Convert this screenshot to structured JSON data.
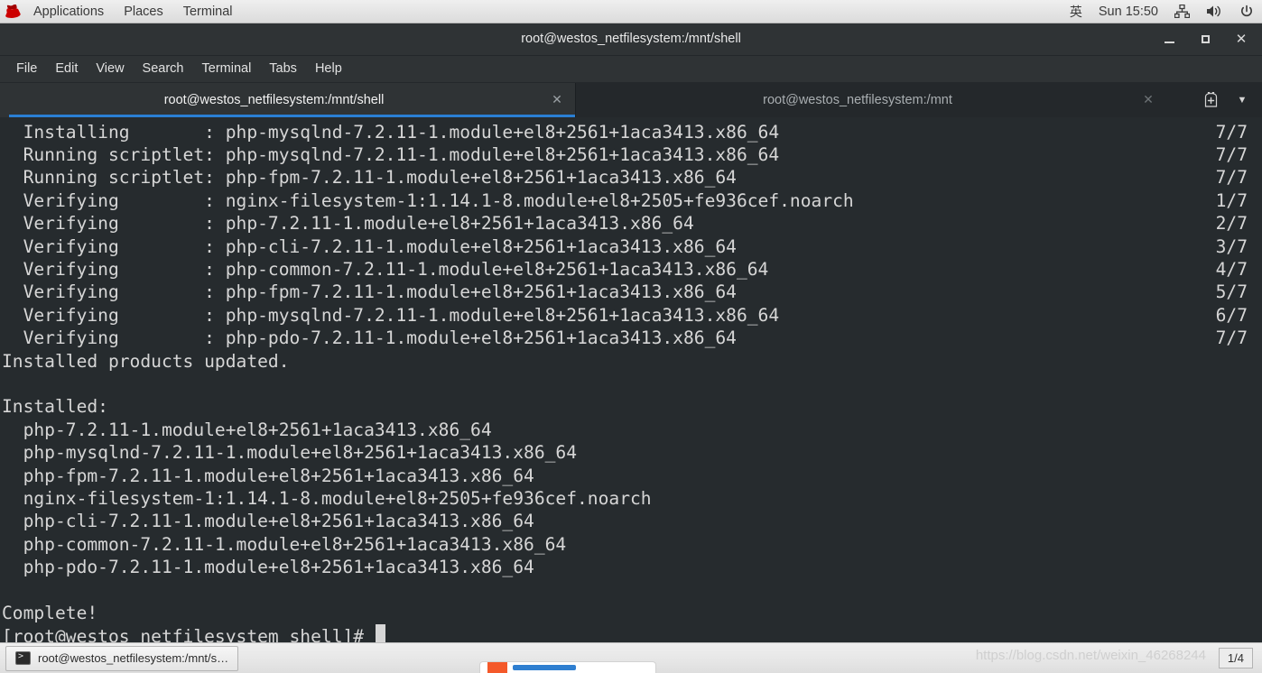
{
  "top_bar": {
    "logo_icon": "redhat-logo-icon",
    "menus": [
      {
        "label": "Applications"
      },
      {
        "label": "Places"
      },
      {
        "label": "Terminal"
      }
    ],
    "ime_indicator": "英",
    "clock": "Sun 15:50",
    "tray_icons": [
      {
        "name": "network-icon",
        "glyph": "⛗"
      },
      {
        "name": "volume-icon",
        "glyph": "🔊"
      },
      {
        "name": "power-icon",
        "glyph": "⏻"
      }
    ]
  },
  "window": {
    "title": "root@westos_netfilesystem:/mnt/shell",
    "controls": {
      "minimize": "minimize-button",
      "maximize": "maximize-button",
      "close_label": "✕"
    }
  },
  "menubar": {
    "items": [
      {
        "label": "File"
      },
      {
        "label": "Edit"
      },
      {
        "label": "View"
      },
      {
        "label": "Search"
      },
      {
        "label": "Terminal"
      },
      {
        "label": "Tabs"
      },
      {
        "label": "Help"
      }
    ]
  },
  "tabs": {
    "active": {
      "label": "root@westos_netfilesystem:/mnt/shell",
      "close_label": "✕"
    },
    "inactive": {
      "label": "root@westos_netfilesystem:/mnt",
      "close_label": "✕"
    },
    "new_tab_label": "⊞",
    "dropdown_label": "▼"
  },
  "terminal": {
    "lines": [
      {
        "text": "  Installing       : php-mysqlnd-7.2.11-1.module+el8+2561+1aca3413.x86_64",
        "count": "7/7"
      },
      {
        "text": "  Running scriptlet: php-mysqlnd-7.2.11-1.module+el8+2561+1aca3413.x86_64",
        "count": "7/7"
      },
      {
        "text": "  Running scriptlet: php-fpm-7.2.11-1.module+el8+2561+1aca3413.x86_64",
        "count": "7/7"
      },
      {
        "text": "  Verifying        : nginx-filesystem-1:1.14.1-8.module+el8+2505+fe936cef.noarch",
        "count": "1/7"
      },
      {
        "text": "  Verifying        : php-7.2.11-1.module+el8+2561+1aca3413.x86_64",
        "count": "2/7"
      },
      {
        "text": "  Verifying        : php-cli-7.2.11-1.module+el8+2561+1aca3413.x86_64",
        "count": "3/7"
      },
      {
        "text": "  Verifying        : php-common-7.2.11-1.module+el8+2561+1aca3413.x86_64",
        "count": "4/7"
      },
      {
        "text": "  Verifying        : php-fpm-7.2.11-1.module+el8+2561+1aca3413.x86_64",
        "count": "5/7"
      },
      {
        "text": "  Verifying        : php-mysqlnd-7.2.11-1.module+el8+2561+1aca3413.x86_64",
        "count": "6/7"
      },
      {
        "text": "  Verifying        : php-pdo-7.2.11-1.module+el8+2561+1aca3413.x86_64",
        "count": "7/7"
      },
      {
        "text": "Installed products updated.",
        "count": ""
      },
      {
        "text": "",
        "count": ""
      },
      {
        "text": "Installed:",
        "count": ""
      },
      {
        "text": "  php-7.2.11-1.module+el8+2561+1aca3413.x86_64",
        "count": ""
      },
      {
        "text": "  php-mysqlnd-7.2.11-1.module+el8+2561+1aca3413.x86_64",
        "count": ""
      },
      {
        "text": "  php-fpm-7.2.11-1.module+el8+2561+1aca3413.x86_64",
        "count": ""
      },
      {
        "text": "  nginx-filesystem-1:1.14.1-8.module+el8+2505+fe936cef.noarch",
        "count": ""
      },
      {
        "text": "  php-cli-7.2.11-1.module+el8+2561+1aca3413.x86_64",
        "count": ""
      },
      {
        "text": "  php-common-7.2.11-1.module+el8+2561+1aca3413.x86_64",
        "count": ""
      },
      {
        "text": "  php-pdo-7.2.11-1.module+el8+2561+1aca3413.x86_64",
        "count": ""
      },
      {
        "text": "",
        "count": ""
      },
      {
        "text": "Complete!",
        "count": ""
      }
    ],
    "prompt": "[root@westos_netfilesystem shell]# "
  },
  "taskbar": {
    "window_button_title": "root@westos_netfilesystem:/mnt/s…",
    "workspace_indicator": "1/4"
  },
  "watermark": "https://blog.csdn.net/weixin_46268244",
  "colors": {
    "terminal_background": "#262b2e",
    "terminal_foreground": "#d6d6d6",
    "tab_accent": "#2a7fd4",
    "titlebar_background": "#2f3335",
    "panel_background": "#e6e6e6"
  }
}
